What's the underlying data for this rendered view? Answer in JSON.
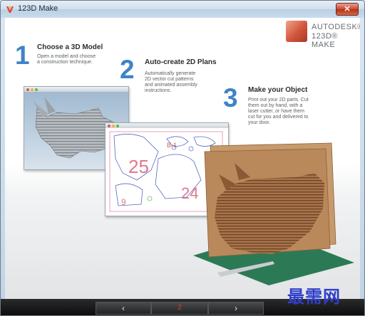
{
  "window": {
    "title": "123D Make"
  },
  "brand": {
    "line1": "AUTODESK®",
    "line2": "123D® MAKE"
  },
  "steps": [
    {
      "number": "1",
      "title": "Choose a 3D Model",
      "desc": [
        "Open a model and choose",
        "a construction technique."
      ]
    },
    {
      "number": "2",
      "title": "Auto-create 2D Plans",
      "desc": [
        "Automatically generate",
        "2D vector cut patterns",
        "and animated assembly",
        "instructions."
      ]
    },
    {
      "number": "3",
      "title": "Make your Object",
      "desc": [
        "Print out your 2D parts. Cut",
        "them out by hand, with a",
        "laser cutter, or have them",
        "cut for you and delivered to",
        "your door."
      ]
    }
  ],
  "plans": {
    "label_a": "25",
    "label_b": "24",
    "label_c": "B-1",
    "label_d": "9"
  },
  "nav": {
    "prev": "‹",
    "current": "2",
    "next": "›"
  },
  "watermark": "最需网",
  "colors": {
    "accent": "#3f84c6",
    "cardboard": "#a9744a",
    "mat": "#2c7a55"
  }
}
